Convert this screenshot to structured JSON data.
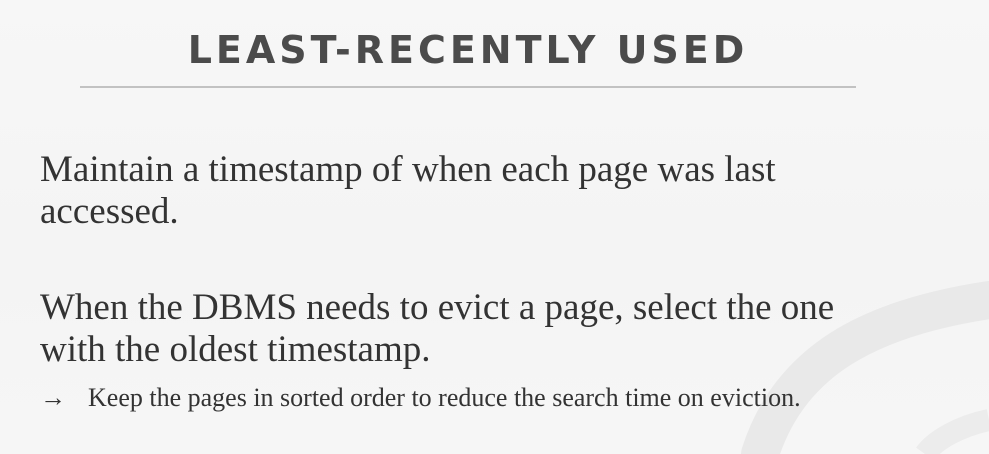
{
  "slide": {
    "title": "LEAST-RECENTLY USED",
    "paragraphs": [
      "Maintain a timestamp of when each page was last accessed.",
      "When the DBMS needs to evict a page, select the one with the oldest timestamp."
    ],
    "sub_bullet": {
      "icon": "arrow-right-icon",
      "glyph": "→",
      "text": "Keep the pages in sorted order to reduce the search time on eviction."
    }
  },
  "colors": {
    "background": "#f5f5f5",
    "title": "#4b4b4b",
    "body_text": "#333333",
    "rule": "#c2c2c2"
  }
}
